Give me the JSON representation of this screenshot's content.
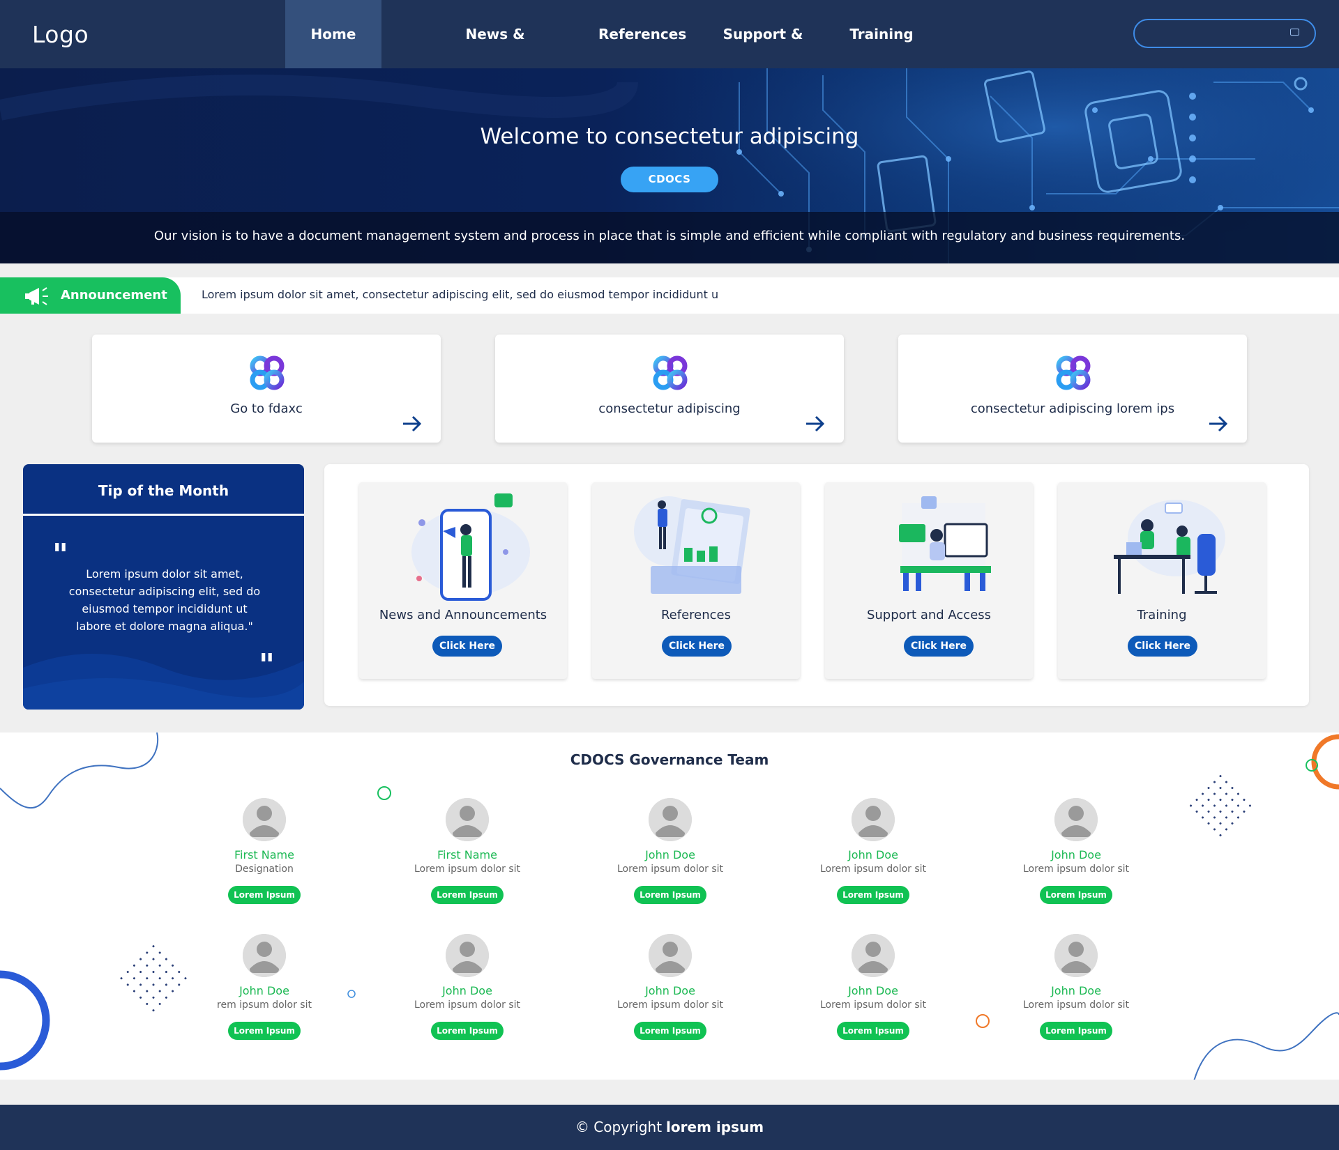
{
  "nav": {
    "logo": "Logo",
    "items": [
      {
        "label": "Home",
        "active": true
      },
      {
        "label": "News & Announcements"
      },
      {
        "label": "References"
      },
      {
        "label": "Support & Access"
      },
      {
        "label": "Training"
      }
    ],
    "search": {
      "value": "",
      "placeholder": ""
    }
  },
  "hero": {
    "title": "Welcome to consectetur adipiscing",
    "badge": "CDOCS",
    "vision": "Our vision is to have a document management system and process in place that is simple and efficient while compliant with regulatory and business requirements."
  },
  "announcement": {
    "label": "Announcement",
    "text": "Lorem ipsum dolor sit amet, consectetur adipiscing elit, sed do eiusmod tempor incididunt u",
    "icon": "megaphone-icon"
  },
  "quick_links": [
    {
      "label": "Go to fdaxc"
    },
    {
      "label": "consectetur adipiscing"
    },
    {
      "label": "consectetur adipiscing lorem ips"
    }
  ],
  "tip": {
    "title": "Tip of the Month",
    "quote": "Lorem ipsum dolor sit amet, consectetur adipiscing elit, sed do eiusmod tempor incididunt ut labore et dolore magna aliqua.\""
  },
  "services": [
    {
      "title": "News and Announcements",
      "button": "Click Here"
    },
    {
      "title": "References",
      "button": "Click Here"
    },
    {
      "title": "Support and Access",
      "button": "Click Here"
    },
    {
      "title": "Training",
      "button": "Click Here"
    }
  ],
  "team": {
    "title": "CDOCS Governance Team",
    "members": [
      {
        "name": "First Name",
        "role": "Designation",
        "button": "Lorem Ipsum"
      },
      {
        "name": "First Name",
        "role": "Lorem ipsum dolor sit",
        "button": "Lorem Ipsum"
      },
      {
        "name": "John Doe",
        "role": "Lorem ipsum dolor sit",
        "button": "Lorem Ipsum"
      },
      {
        "name": "John Doe",
        "role": "Lorem ipsum dolor sit",
        "button": "Lorem Ipsum"
      },
      {
        "name": "John Doe",
        "role": "Lorem ipsum dolor sit",
        "button": "Lorem Ipsum"
      },
      {
        "name": "John Doe",
        "role": "rem ipsum dolor sit",
        "button": "Lorem Ipsum"
      },
      {
        "name": "John Doe",
        "role": "Lorem ipsum dolor sit",
        "button": "Lorem Ipsum"
      },
      {
        "name": "John Doe",
        "role": "Lorem ipsum dolor sit",
        "button": "Lorem Ipsum"
      },
      {
        "name": "John Doe",
        "role": "Lorem ipsum dolor sit",
        "button": "Lorem Ipsum"
      },
      {
        "name": "John Doe",
        "role": "Lorem ipsum dolor sit",
        "button": "Lorem Ipsum"
      }
    ]
  },
  "footer": {
    "copyright": "© Copyright",
    "brand": "lorem ipsum"
  },
  "colors": {
    "nav_bg": "#1f3358",
    "accent_green": "#18c05f",
    "accent_blue": "#0d5ab9",
    "hero_badge": "#37a3f4",
    "tip_bg": "#0a3182"
  }
}
